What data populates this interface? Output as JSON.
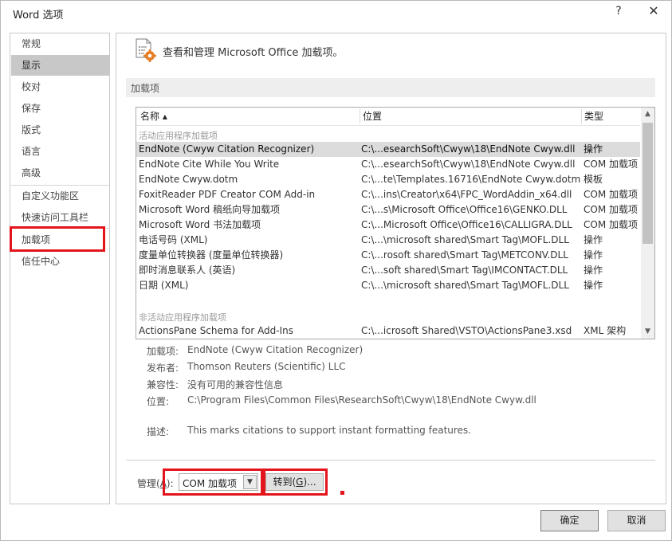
{
  "window": {
    "title": "Word 选项",
    "help_label": "?",
    "close_label": "✕"
  },
  "sidebar": {
    "items": [
      {
        "label": "常规"
      },
      {
        "label": "显示"
      },
      {
        "label": "校对"
      },
      {
        "label": "保存"
      },
      {
        "label": "版式"
      },
      {
        "label": "语言"
      },
      {
        "label": "高级"
      },
      {
        "label": "自定义功能区"
      },
      {
        "label": "快速访问工具栏"
      },
      {
        "label": "加载项"
      },
      {
        "label": "信任中心"
      }
    ],
    "active_item": "加载项"
  },
  "header": {
    "text": "查看和管理 Microsoft Office 加载项。",
    "icon": "addins-settings-icon"
  },
  "section": {
    "label": "加载项"
  },
  "addins_table": {
    "columns": {
      "name": "名称 ▴",
      "location": "位置",
      "type": "类型"
    },
    "active_group_label": "活动应用程序加载项",
    "inactive_group_label": "非活动应用程序加载项",
    "active_rows": [
      {
        "name": "EndNote (Cwyw Citation Recognizer)",
        "location": "C:\\...esearchSoft\\Cwyw\\18\\EndNote Cwyw.dll",
        "type": "操作"
      },
      {
        "name": "EndNote Cite While You Write",
        "location": "C:\\...esearchSoft\\Cwyw\\18\\EndNote Cwyw.dll",
        "type": "COM 加载项"
      },
      {
        "name": "EndNote Cwyw.dotm",
        "location": "C:\\...te\\Templates.16716\\EndNote Cwyw.dotm",
        "type": "模板"
      },
      {
        "name": "FoxitReader PDF Creator COM Add-in",
        "location": "C:\\...ins\\Creator\\x64\\FPC_WordAddin_x64.dll",
        "type": "COM 加载项"
      },
      {
        "name": "Microsoft Word 稿纸向导加载项",
        "location": "C:\\...s\\Microsoft Office\\Office16\\GENKO.DLL",
        "type": "COM 加载项"
      },
      {
        "name": "Microsoft Word 书法加载项",
        "location": "C:\\...Microsoft Office\\Office16\\CALLIGRA.DLL",
        "type": "COM 加载项"
      },
      {
        "name": "电话号码 (XML)",
        "location": "C:\\...\\microsoft shared\\Smart Tag\\MOFL.DLL",
        "type": "操作"
      },
      {
        "name": "度量单位转换器 (度量单位转换器)",
        "location": "C:\\...rosoft shared\\Smart Tag\\METCONV.DLL",
        "type": "操作"
      },
      {
        "name": "即时消息联系人 (英语)",
        "location": "C:\\...soft shared\\Smart Tag\\IMCONTACT.DLL",
        "type": "操作"
      },
      {
        "name": "日期 (XML)",
        "location": "C:\\...\\microsoft shared\\Smart Tag\\MOFL.DLL",
        "type": "操作"
      }
    ],
    "inactive_rows": [
      {
        "name": "ActionsPane Schema for Add-Ins",
        "location": "C:\\...icrosoft Shared\\VSTO\\ActionsPane3.xsd",
        "type": "XML 架构"
      }
    ]
  },
  "details": {
    "addin_label": "加载项:",
    "addin_value": "EndNote (Cwyw Citation Recognizer)",
    "publisher_label": "发布者:",
    "publisher_value": "Thomson Reuters (Scientific) LLC",
    "compat_label": "兼容性:",
    "compat_value": "没有可用的兼容性信息",
    "location_label": "位置:",
    "location_value": "C:\\Program Files\\Common Files\\ResearchSoft\\Cwyw\\18\\EndNote Cwyw.dll",
    "desc_label": "描述:",
    "desc_value": "This marks citations to support instant formatting features."
  },
  "manage": {
    "label_prefix": "管理(",
    "label_key": "A",
    "label_suffix": "):",
    "selected": "COM 加载项",
    "go_prefix": "转到(",
    "go_key": "G",
    "go_suffix": ")..."
  },
  "footer": {
    "ok": "确定",
    "cancel": "取消"
  },
  "colors": {
    "highlight_red": "#e4141c",
    "selected_row": "#dcdcdc",
    "active_sidebar": "#c8c8c8"
  }
}
